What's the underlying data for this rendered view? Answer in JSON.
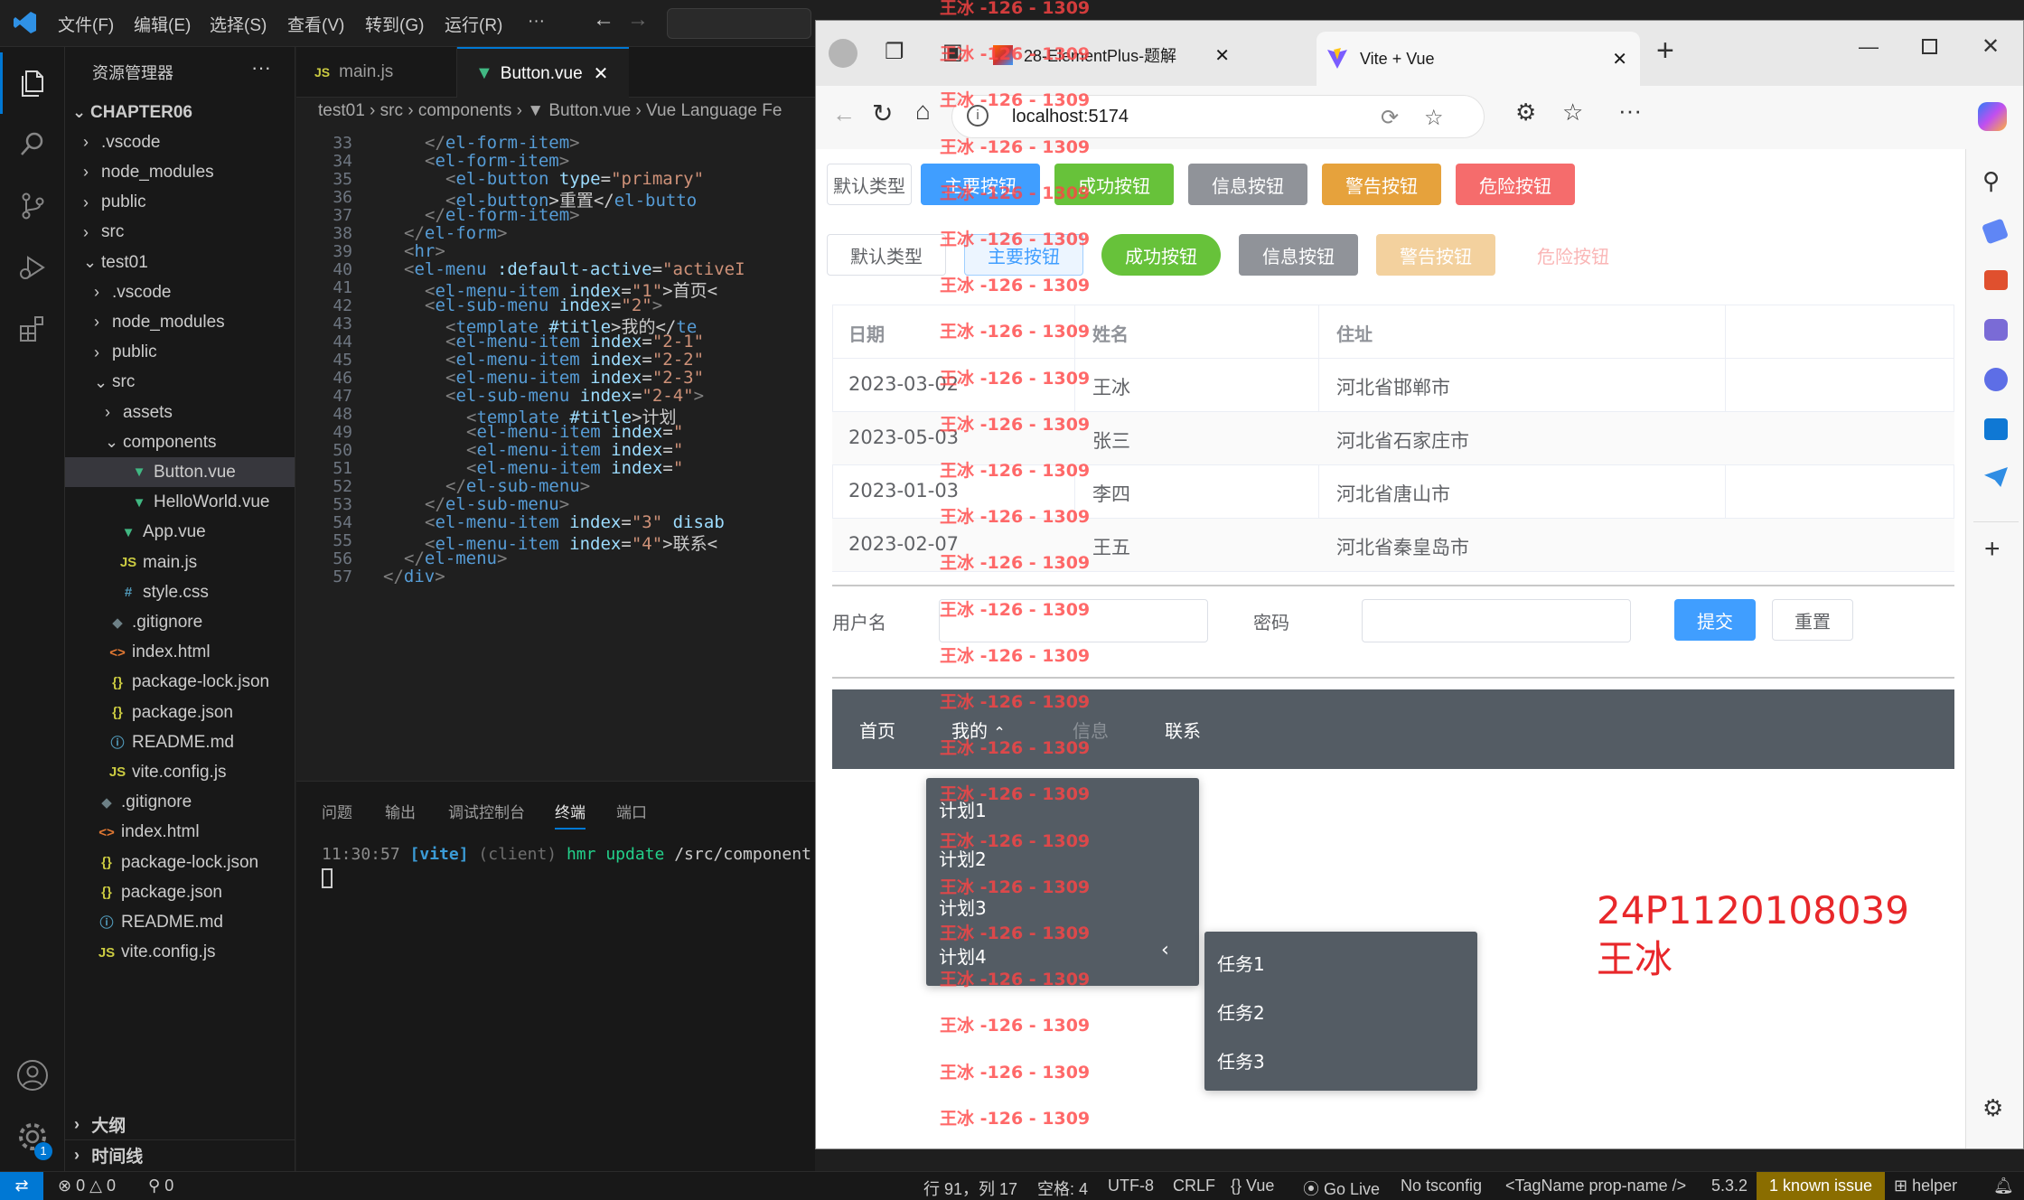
{
  "vscode": {
    "menu": [
      "文件(F)",
      "编辑(E)",
      "选择(S)",
      "查看(V)",
      "转到(G)",
      "运行(R)",
      "···"
    ],
    "settings_badge": "1"
  },
  "explorer": {
    "title": "资源管理器",
    "outline": "大纲",
    "timeline": "时间线",
    "items": [
      {
        "label": "CHAPTER06",
        "depth": 0,
        "chev": "⌄",
        "icon": "",
        "bold": true
      },
      {
        "label": ".vscode",
        "depth": 1,
        "chev": "›",
        "icon": ""
      },
      {
        "label": "node_modules",
        "depth": 1,
        "chev": "›",
        "icon": ""
      },
      {
        "label": "public",
        "depth": 1,
        "chev": "›",
        "icon": ""
      },
      {
        "label": "src",
        "depth": 1,
        "chev": "›",
        "icon": ""
      },
      {
        "label": "test01",
        "depth": 1,
        "chev": "⌄",
        "icon": ""
      },
      {
        "label": ".vscode",
        "depth": 2,
        "chev": "›",
        "icon": ""
      },
      {
        "label": "node_modules",
        "depth": 2,
        "chev": "›",
        "icon": ""
      },
      {
        "label": "public",
        "depth": 2,
        "chev": "›",
        "icon": ""
      },
      {
        "label": "src",
        "depth": 2,
        "chev": "⌄",
        "icon": ""
      },
      {
        "label": "assets",
        "depth": 3,
        "chev": "›",
        "icon": ""
      },
      {
        "label": "components",
        "depth": 3,
        "chev": "⌄",
        "icon": ""
      },
      {
        "label": "Button.vue",
        "depth": 4,
        "chev": "",
        "icon": "vue",
        "selected": true
      },
      {
        "label": "HelloWorld.vue",
        "depth": 4,
        "chev": "",
        "icon": "vue"
      },
      {
        "label": "App.vue",
        "depth": 3,
        "chev": "",
        "icon": "vue"
      },
      {
        "label": "main.js",
        "depth": 3,
        "chev": "",
        "icon": "js"
      },
      {
        "label": "style.css",
        "depth": 3,
        "chev": "",
        "icon": "css"
      },
      {
        "label": ".gitignore",
        "depth": 2,
        "chev": "",
        "icon": "git"
      },
      {
        "label": "index.html",
        "depth": 2,
        "chev": "",
        "icon": "html"
      },
      {
        "label": "package-lock.json",
        "depth": 2,
        "chev": "",
        "icon": "json"
      },
      {
        "label": "package.json",
        "depth": 2,
        "chev": "",
        "icon": "json"
      },
      {
        "label": "README.md",
        "depth": 2,
        "chev": "",
        "icon": "info"
      },
      {
        "label": "vite.config.js",
        "depth": 2,
        "chev": "",
        "icon": "js"
      },
      {
        "label": ".gitignore",
        "depth": 1,
        "chev": "",
        "icon": "git"
      },
      {
        "label": "index.html",
        "depth": 1,
        "chev": "",
        "icon": "html"
      },
      {
        "label": "package-lock.json",
        "depth": 1,
        "chev": "",
        "icon": "json"
      },
      {
        "label": "package.json",
        "depth": 1,
        "chev": "",
        "icon": "json"
      },
      {
        "label": "README.md",
        "depth": 1,
        "chev": "",
        "icon": "info"
      },
      {
        "label": "vite.config.js",
        "depth": 1,
        "chev": "",
        "icon": "js"
      }
    ]
  },
  "editor": {
    "tabs": [
      "main.js",
      "Button.vue"
    ],
    "breadcrumb": "test01 › src › components › ▼ Button.vue › Vue Language Fe",
    "lines": [
      {
        "n": "33",
        "indent": 5,
        "parts": [
          [
            "br",
            "</"
          ],
          [
            "tg",
            "el-form-item"
          ],
          [
            "br",
            ">"
          ]
        ]
      },
      {
        "n": "34",
        "indent": 5,
        "parts": [
          [
            "br",
            "<"
          ],
          [
            "tg",
            "el-form-item"
          ],
          [
            "br",
            ">"
          ]
        ]
      },
      {
        "n": "35",
        "indent": 7,
        "parts": [
          [
            "br",
            "<"
          ],
          [
            "tg",
            "el-button"
          ],
          [
            "at",
            " type"
          ],
          [
            "tx",
            "="
          ],
          [
            "st",
            "\"primary\""
          ]
        ]
      },
      {
        "n": "36",
        "indent": 7,
        "parts": [
          [
            "br",
            "<"
          ],
          [
            "tg",
            "el-button"
          ],
          [
            "tx",
            ">重置</"
          ],
          [
            "tg",
            "el-butto"
          ]
        ]
      },
      {
        "n": "37",
        "indent": 5,
        "parts": [
          [
            "br",
            "</"
          ],
          [
            "tg",
            "el-form-item"
          ],
          [
            "br",
            ">"
          ]
        ]
      },
      {
        "n": "38",
        "indent": 3,
        "parts": [
          [
            "br",
            "</"
          ],
          [
            "tg",
            "el-form"
          ],
          [
            "br",
            ">"
          ]
        ]
      },
      {
        "n": "39",
        "indent": 3,
        "parts": [
          [
            "br",
            "<"
          ],
          [
            "tg",
            "hr"
          ],
          [
            "br",
            ">"
          ]
        ]
      },
      {
        "n": "40",
        "indent": 3,
        "parts": [
          [
            "br",
            "<"
          ],
          [
            "tg",
            "el-menu"
          ],
          [
            "at",
            " :default-active"
          ],
          [
            "tx",
            "="
          ],
          [
            "st",
            "\"activeI"
          ]
        ]
      },
      {
        "n": "41",
        "indent": 5,
        "parts": [
          [
            "br",
            "<"
          ],
          [
            "tg",
            "el-menu-item"
          ],
          [
            "at",
            " index"
          ],
          [
            "tx",
            "="
          ],
          [
            "st",
            "\"1\""
          ],
          [
            "tx",
            ">首页<"
          ]
        ]
      },
      {
        "n": "42",
        "indent": 5,
        "parts": [
          [
            "br",
            "<"
          ],
          [
            "tg",
            "el-sub-menu"
          ],
          [
            "at",
            " index"
          ],
          [
            "tx",
            "="
          ],
          [
            "st",
            "\"2\""
          ],
          [
            "br",
            ">"
          ]
        ]
      },
      {
        "n": "43",
        "indent": 7,
        "parts": [
          [
            "br",
            "<"
          ],
          [
            "tg",
            "template"
          ],
          [
            "at",
            " #title"
          ],
          [
            "tx",
            ">我的</"
          ],
          [
            "tg",
            "te"
          ]
        ]
      },
      {
        "n": "44",
        "indent": 7,
        "parts": [
          [
            "br",
            "<"
          ],
          [
            "tg",
            "el-menu-item"
          ],
          [
            "at",
            " index"
          ],
          [
            "tx",
            "="
          ],
          [
            "st",
            "\"2-1\""
          ]
        ]
      },
      {
        "n": "45",
        "indent": 7,
        "parts": [
          [
            "br",
            "<"
          ],
          [
            "tg",
            "el-menu-item"
          ],
          [
            "at",
            " index"
          ],
          [
            "tx",
            "="
          ],
          [
            "st",
            "\"2-2\""
          ]
        ]
      },
      {
        "n": "46",
        "indent": 7,
        "parts": [
          [
            "br",
            "<"
          ],
          [
            "tg",
            "el-menu-item"
          ],
          [
            "at",
            " index"
          ],
          [
            "tx",
            "="
          ],
          [
            "st",
            "\"2-3\""
          ]
        ]
      },
      {
        "n": "47",
        "indent": 7,
        "parts": [
          [
            "br",
            "<"
          ],
          [
            "tg",
            "el-sub-menu"
          ],
          [
            "at",
            " index"
          ],
          [
            "tx",
            "="
          ],
          [
            "st",
            "\"2-4\""
          ],
          [
            "br",
            ">"
          ]
        ]
      },
      {
        "n": "48",
        "indent": 9,
        "parts": [
          [
            "br",
            "<"
          ],
          [
            "tg",
            "template"
          ],
          [
            "at",
            " #title"
          ],
          [
            "tx",
            ">计划"
          ]
        ]
      },
      {
        "n": "49",
        "indent": 9,
        "parts": [
          [
            "br",
            "<"
          ],
          [
            "tg",
            "el-menu-item"
          ],
          [
            "at",
            " index"
          ],
          [
            "tx",
            "="
          ],
          [
            "st",
            "\""
          ]
        ]
      },
      {
        "n": "50",
        "indent": 9,
        "parts": [
          [
            "br",
            "<"
          ],
          [
            "tg",
            "el-menu-item"
          ],
          [
            "at",
            " index"
          ],
          [
            "tx",
            "="
          ],
          [
            "st",
            "\""
          ]
        ]
      },
      {
        "n": "51",
        "indent": 9,
        "parts": [
          [
            "br",
            "<"
          ],
          [
            "tg",
            "el-menu-item"
          ],
          [
            "at",
            " index"
          ],
          [
            "tx",
            "="
          ],
          [
            "st",
            "\""
          ]
        ]
      },
      {
        "n": "52",
        "indent": 7,
        "parts": [
          [
            "br",
            "</"
          ],
          [
            "tg",
            "el-sub-menu"
          ],
          [
            "br",
            ">"
          ]
        ]
      },
      {
        "n": "53",
        "indent": 5,
        "parts": [
          [
            "br",
            "</"
          ],
          [
            "tg",
            "el-sub-menu"
          ],
          [
            "br",
            ">"
          ]
        ]
      },
      {
        "n": "54",
        "indent": 5,
        "parts": [
          [
            "br",
            "<"
          ],
          [
            "tg",
            "el-menu-item"
          ],
          [
            "at",
            " index"
          ],
          [
            "tx",
            "="
          ],
          [
            "st",
            "\"3\""
          ],
          [
            "at",
            " disab"
          ]
        ]
      },
      {
        "n": "55",
        "indent": 5,
        "parts": [
          [
            "br",
            "<"
          ],
          [
            "tg",
            "el-menu-item"
          ],
          [
            "at",
            " index"
          ],
          [
            "tx",
            "="
          ],
          [
            "st",
            "\"4\""
          ],
          [
            "tx",
            ">联系<"
          ]
        ]
      },
      {
        "n": "56",
        "indent": 3,
        "parts": [
          [
            "br",
            "</"
          ],
          [
            "tg",
            "el-menu"
          ],
          [
            "br",
            ">"
          ]
        ]
      },
      {
        "n": "57",
        "indent": 1,
        "parts": [
          [
            "br",
            "</"
          ],
          [
            "tg",
            "div"
          ],
          [
            "br",
            ">"
          ]
        ]
      }
    ]
  },
  "panel": {
    "tabs": [
      "问题",
      "输出",
      "调试控制台",
      "终端",
      "端口"
    ],
    "terminal": {
      "time": "11:30:57",
      "tag": "[vite]",
      "client": "(client)",
      "msg": "hmr update",
      "path": "/src/component"
    }
  },
  "status": {
    "errors": "0",
    "warnings": "0",
    "ports": "0",
    "position": "行 91，列 17",
    "spaces": "空格: 4",
    "encoding": "UTF-8",
    "eol": "CRLF",
    "language": "Vue",
    "golive": "Go Live",
    "tsconfig": "No tsconfig",
    "tagname": "<TagName prop-name />",
    "version": "5.3.2",
    "issue": "1 known issue",
    "helper": "helper"
  },
  "browser": {
    "tabs": [
      "28-ElementPlus-题解",
      "Vite + Vue"
    ],
    "url": {
      "host": "localhost:5174"
    }
  },
  "page": {
    "buttons_row1": [
      "默认类型",
      "主要按钮",
      "成功按钮",
      "信息按钮",
      "警告按钮",
      "危险按钮"
    ],
    "buttons_row2": [
      "默认类型",
      "主要按钮",
      "成功按钮",
      "信息按钮",
      "警告按钮",
      "危险按钮"
    ],
    "table": {
      "headers": [
        "日期",
        "姓名",
        "住址"
      ],
      "rows": [
        [
          "2023-03-02",
          "王冰",
          "河北省邯郸市"
        ],
        [
          "2023-05-03",
          "张三",
          "河北省石家庄市"
        ],
        [
          "2023-01-03",
          "李四",
          "河北省唐山市"
        ],
        [
          "2023-02-07",
          "王五",
          "河北省秦皇岛市"
        ]
      ]
    },
    "form": {
      "username_label": "用户名",
      "password_label": "密码",
      "submit": "提交",
      "reset": "重置"
    },
    "menu": {
      "items": [
        "首页",
        "我的",
        "信息",
        "联系"
      ],
      "plans": [
        "计划1",
        "计划2",
        "计划3",
        "计划4"
      ],
      "tasks": [
        "任务1",
        "任务2",
        "任务3"
      ]
    },
    "annotation": {
      "id": "24P1120108039",
      "name": "王冰"
    }
  },
  "watermark": "王冰 -126 - 1309"
}
